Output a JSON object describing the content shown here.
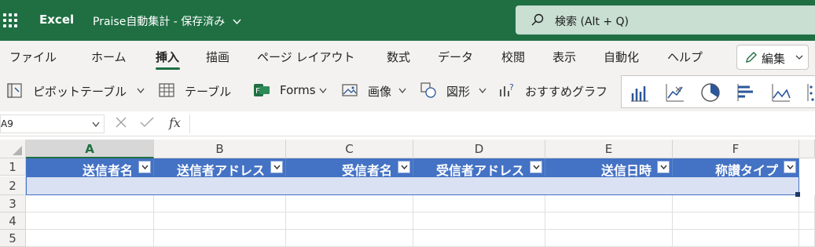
{
  "titlebar": {
    "app_name": "Excel",
    "doc_name": "Praise自動集計 - 保存済み",
    "search_placeholder": "検索 (Alt + Q)",
    "bg_color": "#1f6f43"
  },
  "tabs": [
    {
      "label": "ファイル"
    },
    {
      "label": "ホーム"
    },
    {
      "label": "挿入",
      "active": true
    },
    {
      "label": "描画"
    },
    {
      "label": "ページ レイアウト"
    },
    {
      "label": "数式"
    },
    {
      "label": "データ"
    },
    {
      "label": "校閲"
    },
    {
      "label": "表示"
    },
    {
      "label": "自動化"
    },
    {
      "label": "ヘルプ"
    }
  ],
  "edit_button": {
    "label": "編集"
  },
  "ribbon": {
    "pivot": "ピボットテーブル",
    "table": "テーブル",
    "forms": "Forms",
    "image": "画像",
    "shapes": "図形",
    "recommended_charts": "おすすめグラフ",
    "chart_gallery_icons": [
      "column-chart-icon",
      "line-chart-icon",
      "pie-chart-icon",
      "bar-chart-icon",
      "area-chart-icon",
      "scatter-chart-icon"
    ]
  },
  "formula_bar": {
    "name_box": "A9",
    "fx": "fx",
    "value": ""
  },
  "grid": {
    "columns": [
      "A",
      "B",
      "C",
      "D",
      "E",
      "F"
    ],
    "selected_column": "A",
    "rows": [
      "1",
      "2",
      "3",
      "4",
      "5"
    ],
    "table_headers": [
      "送信者名",
      "送信者アドレス",
      "受信者名",
      "受信者アドレス",
      "送信日時",
      "称讃タイプ"
    ],
    "header_color": "#4472c4",
    "band_color": "#d9e1f2"
  }
}
